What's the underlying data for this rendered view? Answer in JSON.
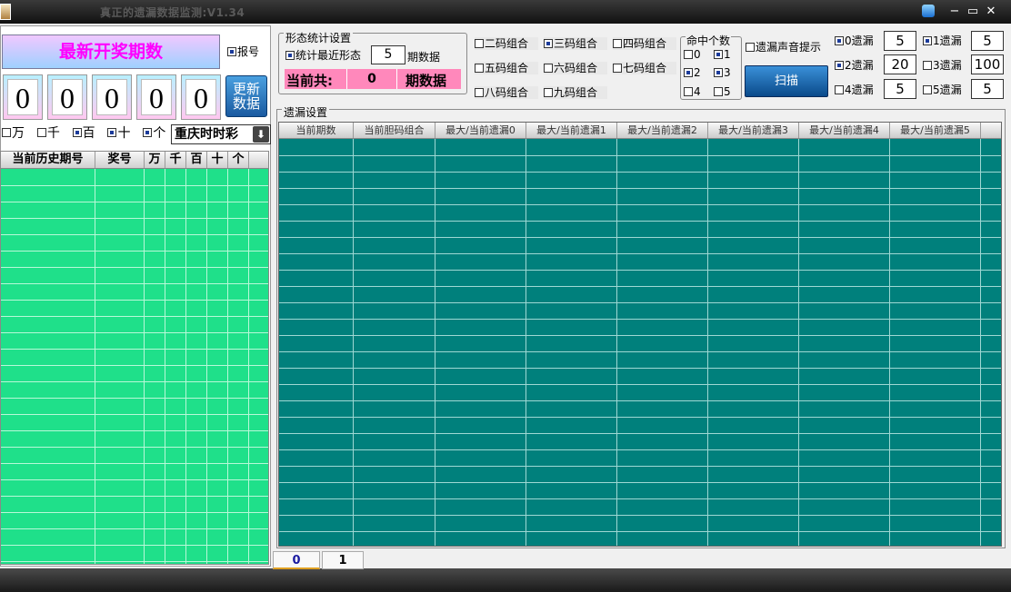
{
  "window": {
    "title": "真正的遗漏数据监测:V1.34",
    "minimize": "−",
    "restore": "▭",
    "close": "✕"
  },
  "left": {
    "latest_title": "最新开奖期数",
    "report_label": "报号",
    "digits": [
      "0",
      "0",
      "0",
      "0",
      "0"
    ],
    "update_button": "更新\n数据",
    "positions": [
      {
        "label": "万",
        "checked": false
      },
      {
        "label": "千",
        "checked": false
      },
      {
        "label": "百",
        "checked": true
      },
      {
        "label": "十",
        "checked": true
      },
      {
        "label": "个",
        "checked": true
      }
    ],
    "lottery": "重庆时时彩",
    "history_headers": [
      "当前历史期号",
      "奖号",
      "万",
      "千",
      "百",
      "十",
      "个"
    ]
  },
  "shape": {
    "legend": "形态统计设置",
    "recent_label": "统计最近形态",
    "recent_count": "5",
    "recent_unit": "期数据",
    "total_label": "当前共:",
    "total_count": "0",
    "total_unit": "期数据"
  },
  "combos": [
    {
      "label": "二码组合",
      "checked": false
    },
    {
      "label": "三码组合",
      "checked": true
    },
    {
      "label": "四码组合",
      "checked": false
    },
    {
      "label": "五码组合",
      "checked": false
    },
    {
      "label": "六码组合",
      "checked": false
    },
    {
      "label": "七码组合",
      "checked": false
    },
    {
      "label": "八码组合",
      "checked": false
    },
    {
      "label": "九码组合",
      "checked": false
    }
  ],
  "hits": {
    "legend": "命中个数",
    "items": [
      {
        "label": "0",
        "checked": false
      },
      {
        "label": "1",
        "checked": true
      },
      {
        "label": "2",
        "checked": true
      },
      {
        "label": "3",
        "checked": true
      },
      {
        "label": "4",
        "checked": false
      },
      {
        "label": "5",
        "checked": false
      }
    ]
  },
  "sound_label": "遗漏声音提示",
  "scan_button": "扫描",
  "misses": [
    {
      "label": "0遗漏",
      "value": "5",
      "checked": true
    },
    {
      "label": "1遗漏",
      "value": "5",
      "checked": true
    },
    {
      "label": "2遗漏",
      "value": "20",
      "checked": true
    },
    {
      "label": "3遗漏",
      "value": "100",
      "checked": false
    },
    {
      "label": "4遗漏",
      "value": "5",
      "checked": false
    },
    {
      "label": "5遗漏",
      "value": "5",
      "checked": false
    }
  ],
  "miss_grid": {
    "legend": "遗漏设置",
    "headers": [
      "当前期数",
      "当前胆码组合",
      "最大/当前遗漏0",
      "最大/当前遗漏1",
      "最大/当前遗漏2",
      "最大/当前遗漏3",
      "最大/当前遗漏4",
      "最大/当前遗漏5"
    ]
  },
  "tabs": [
    "0",
    "1"
  ]
}
